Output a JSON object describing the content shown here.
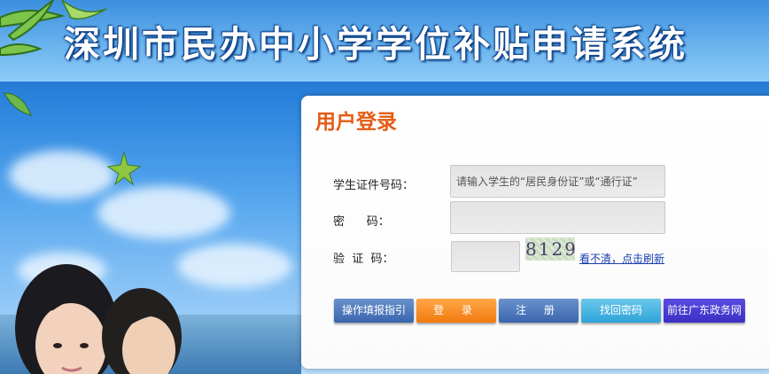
{
  "header": {
    "title": "深圳市民办中小学学位补贴申请系统"
  },
  "login": {
    "heading": "用户登录",
    "id_label": "学生证件号码：",
    "id_placeholder": "请输入学生的“居民身份证”或“通行证”",
    "password_label": "密      码：",
    "captcha_label": "验  证  码：",
    "captcha_value": "8129",
    "refresh_label": "看不清，点击刷新"
  },
  "buttons": {
    "guide": "操作填报指引",
    "login": "登 录",
    "register": "注 册",
    "recover": "找回密码",
    "portal": "前往广东政务网"
  }
}
